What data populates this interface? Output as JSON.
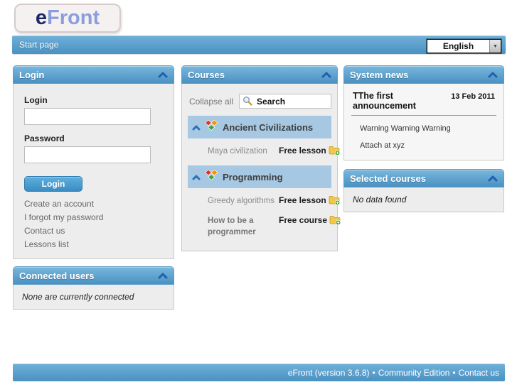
{
  "logo": {
    "e": "e",
    "front": "Front"
  },
  "topbar": {
    "title": "Start page",
    "language_selected": "English"
  },
  "login_panel": {
    "title": "Login",
    "login_label": "Login",
    "login_value": "",
    "password_label": "Password",
    "password_value": "",
    "button_label": "Login",
    "links": [
      "Create an account",
      "I forgot my password",
      "Contact us",
      "Lessons list"
    ]
  },
  "connected_users_panel": {
    "title": "Connected users",
    "message": "None are currently connected"
  },
  "courses_panel": {
    "title": "Courses",
    "collapse_all_label": "Collapse all",
    "search_value": "Search",
    "categories": [
      {
        "name": "Ancient Civilizations",
        "items": [
          {
            "name": "Maya civilization",
            "badge": "Free lesson"
          }
        ]
      },
      {
        "name": "Programming",
        "items": [
          {
            "name": "Greedy algorithms",
            "badge": "Free lesson"
          },
          {
            "name": "How to be a programmer",
            "badge": "Free course"
          }
        ]
      }
    ]
  },
  "system_news_panel": {
    "title": "System news",
    "announcement": {
      "title": "TThe first announcement",
      "date": "13 Feb 2011",
      "lines": [
        "Warning Warning Warning",
        "Attach at xyz"
      ]
    }
  },
  "selected_courses_panel": {
    "title": "Selected courses",
    "message": "No data found"
  },
  "footer": {
    "parts": [
      "eFront (version 3.6.8)",
      "Community Edition",
      "Contact us"
    ],
    "separator": "•"
  },
  "colors": {
    "accent_blue": "#4a92c2",
    "header_gradient_top": "#79b7de",
    "category_bg": "#a6c8e3",
    "chevron_blue": "#1f5fae",
    "button_blue": "#3a8cc2"
  }
}
